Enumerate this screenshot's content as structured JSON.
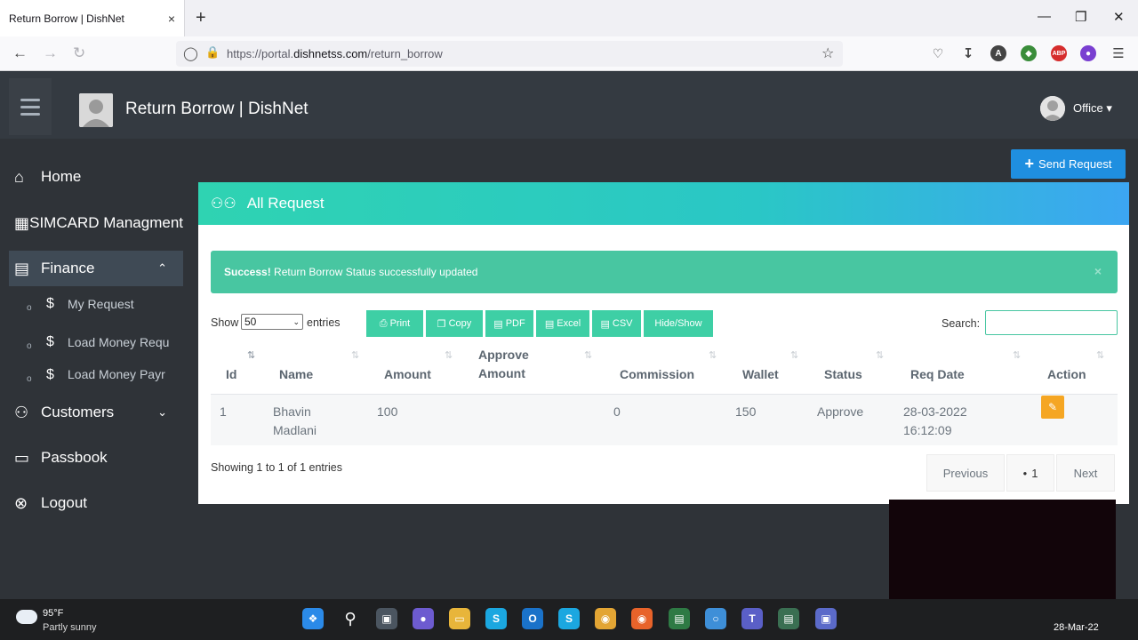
{
  "browser": {
    "tab_title": "Return Borrow | DishNet",
    "tab_close": "×",
    "new_tab": "+",
    "url_prefix": "https://portal.",
    "url_domain": "dishnetss.com",
    "url_path": "/return_borrow"
  },
  "header": {
    "title": "Return Borrow | DishNet",
    "user_name": "Office",
    "user_caret": "▾"
  },
  "sidebar": {
    "items": [
      {
        "label": "Home",
        "icon": "home-icon"
      },
      {
        "label": "SIMCARD Managment",
        "icon": "grid-icon"
      },
      {
        "label": "Finance",
        "icon": "cash-icon"
      },
      {
        "label": "Customers",
        "icon": "users-icon"
      },
      {
        "label": "Passbook",
        "icon": "book-icon"
      },
      {
        "label": "Logout",
        "icon": "close-circle-icon"
      }
    ],
    "sub_items": [
      {
        "label": "My Request"
      },
      {
        "label": "Load Money Requ"
      },
      {
        "label": "Load Money Payr"
      }
    ]
  },
  "main": {
    "send_request_label": "Send Request",
    "card_title": "All Request",
    "alert": {
      "strong": "Success!",
      "message": " Return Borrow Status successfully updated",
      "close": "×"
    },
    "length": {
      "show_label": "Show",
      "value": "50",
      "entries_label": "entries"
    },
    "buttons": [
      "Print",
      "Copy",
      "PDF",
      "Excel",
      "CSV",
      "Hide/Show"
    ],
    "search_label": "Search:",
    "table": {
      "headers": [
        "Id",
        "Name",
        "Amount",
        "Approve Amount",
        "Commission",
        "Wallet",
        "Status",
        "Req Date",
        "Action"
      ],
      "rows": [
        {
          "id": "1",
          "name": "Bhavin Madlani",
          "amount": "100",
          "approve_amount": "",
          "commission": "0",
          "wallet": "150",
          "status": "Approve",
          "req_date": "28-03-2022 16:12:09"
        }
      ]
    },
    "info": "Showing 1 to 1 of 1 entries",
    "pagination": {
      "previous": "Previous",
      "current": "1",
      "next": "Next"
    }
  },
  "taskbar": {
    "temperature": "95°F",
    "weather": "Partly sunny",
    "date": "28-Mar-22"
  },
  "colors": {
    "header_bg": "#343a41",
    "body_bg": "#2f3338",
    "accent_teal": "#3ecfa5",
    "accent_blue": "#1f8fe0",
    "alert_bg": "#48c6a1",
    "action_orange": "#f5a623"
  }
}
